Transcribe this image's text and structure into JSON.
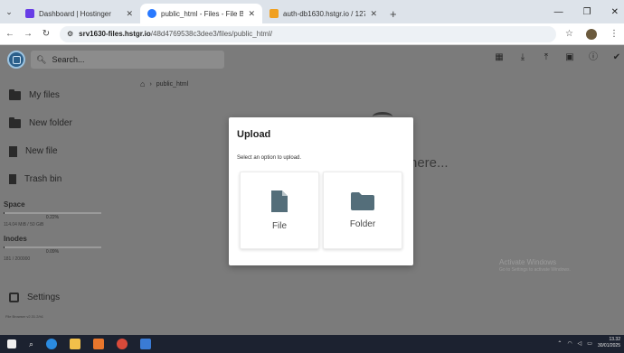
{
  "browser": {
    "tabs": [
      {
        "title": "Dashboard | Hostinger",
        "favicon_color": "#673de6"
      },
      {
        "title": "public_html - Files - File Browser",
        "favicon_color": "#2979ff"
      },
      {
        "title": "auth-db1630.hstgr.io / 127.0.0.1",
        "favicon_color": "#f0a020"
      }
    ],
    "new_tab": "+",
    "url_host": "srv1630-files.hstgr.io",
    "url_path": "/48d4769538c3dee3/files/public_html/"
  },
  "app": {
    "search_placeholder": "Search...",
    "sidebar": {
      "my_files": "My files",
      "new_folder": "New folder",
      "new_file": "New file",
      "trash_bin": "Trash bin",
      "settings": "Settings"
    },
    "space": {
      "title": "Space",
      "percent_label": "0.22%",
      "percent": 0.22,
      "usage": "114.04 MiB / 50 GiB"
    },
    "inodes": {
      "title": "Inodes",
      "percent_label": "0.09%",
      "percent": 0.09,
      "usage": "181 / 200000"
    },
    "version": "File Browser v2.31.2/h1",
    "breadcrumb": "public_html",
    "background_text": "here..."
  },
  "modal": {
    "title": "Upload",
    "description": "Select an option to upload.",
    "file_label": "File",
    "folder_label": "Folder"
  },
  "watermark": {
    "line1": "Activate Windows",
    "line2": "Go to Settings to activate Windows."
  },
  "taskbar": {
    "time": "13.32",
    "date": "30/01/2025"
  }
}
